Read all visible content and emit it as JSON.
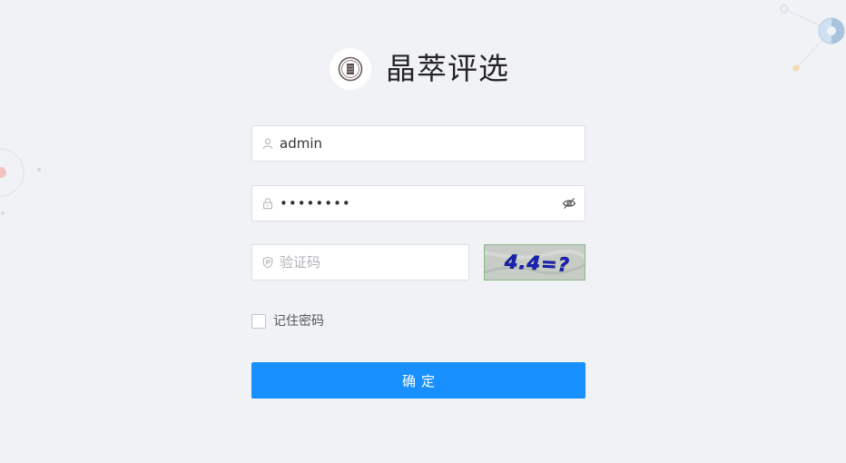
{
  "brand": {
    "title": "晶萃评选",
    "logo_icon": "brand-seal-logo"
  },
  "login_form": {
    "username": {
      "value": "admin",
      "icon": "user-icon"
    },
    "password": {
      "value": "••••••••",
      "icon": "lock-icon",
      "toggle_icon": "eye-off-icon"
    },
    "captcha": {
      "placeholder": "验证码",
      "value": "",
      "icon": "shield-icon",
      "image_text": "4.4=?"
    },
    "remember_label": "记住密码",
    "remember_checked": false,
    "submit_label": "确定"
  },
  "colors": {
    "background": "#f0f2f5",
    "primary": "#1890ff",
    "input_border": "#dcdfe6"
  }
}
